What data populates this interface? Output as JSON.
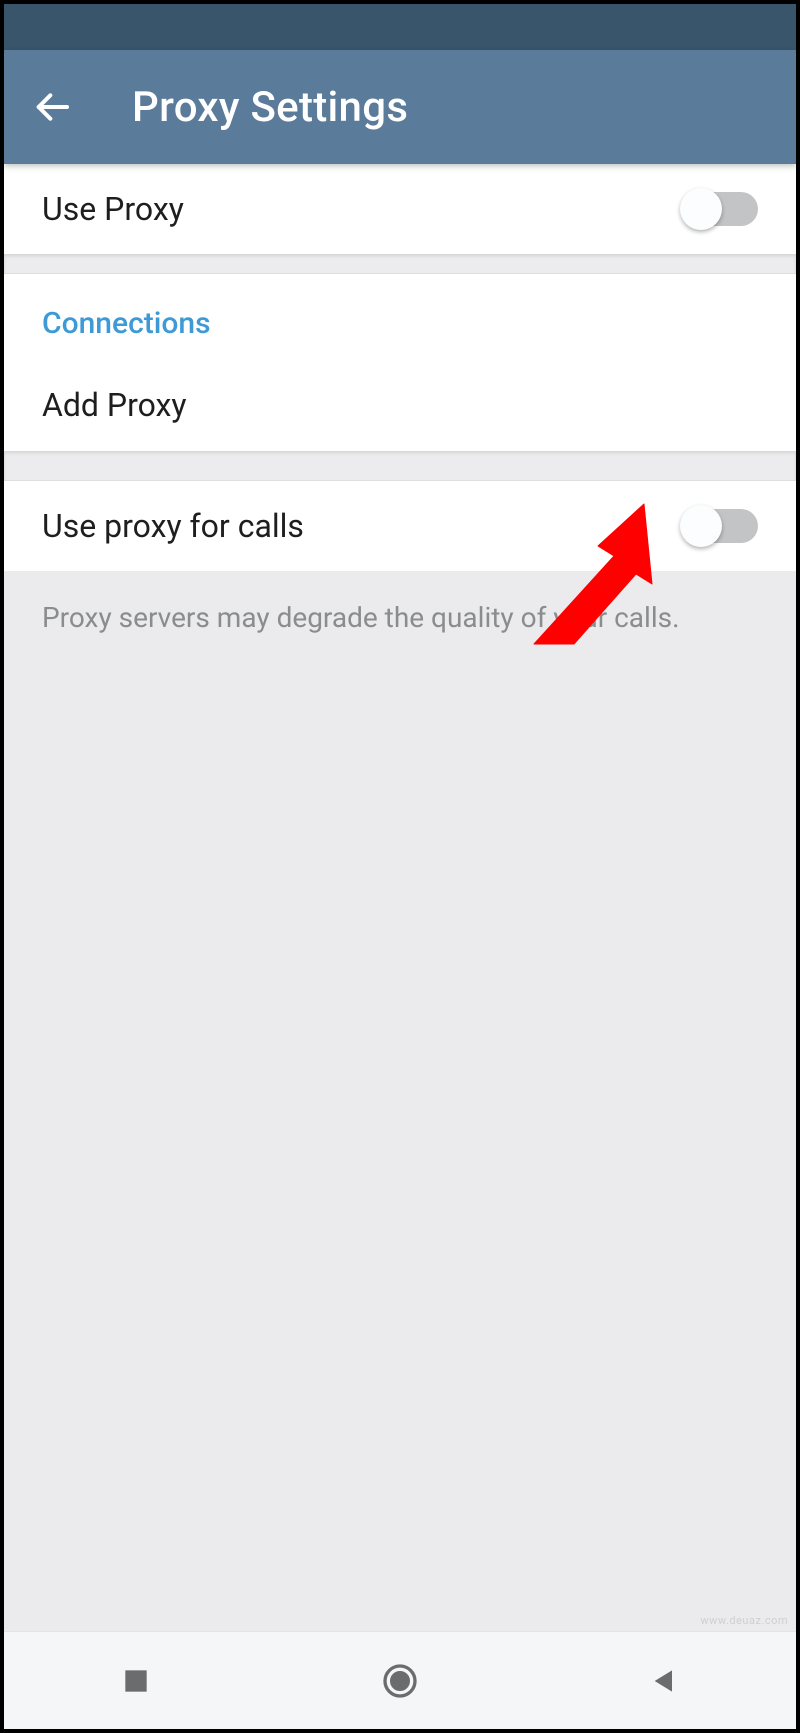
{
  "header": {
    "title": "Proxy Settings"
  },
  "sections": {
    "use_proxy_label": "Use Proxy",
    "connections_header": "Connections",
    "add_proxy_label": "Add Proxy",
    "use_proxy_calls_label": "Use proxy for calls",
    "hint_text": "Proxy servers may degrade the quality of your calls."
  },
  "colors": {
    "section_header_color": "#3e9ad6"
  },
  "watermark": "www.deuaz.com"
}
